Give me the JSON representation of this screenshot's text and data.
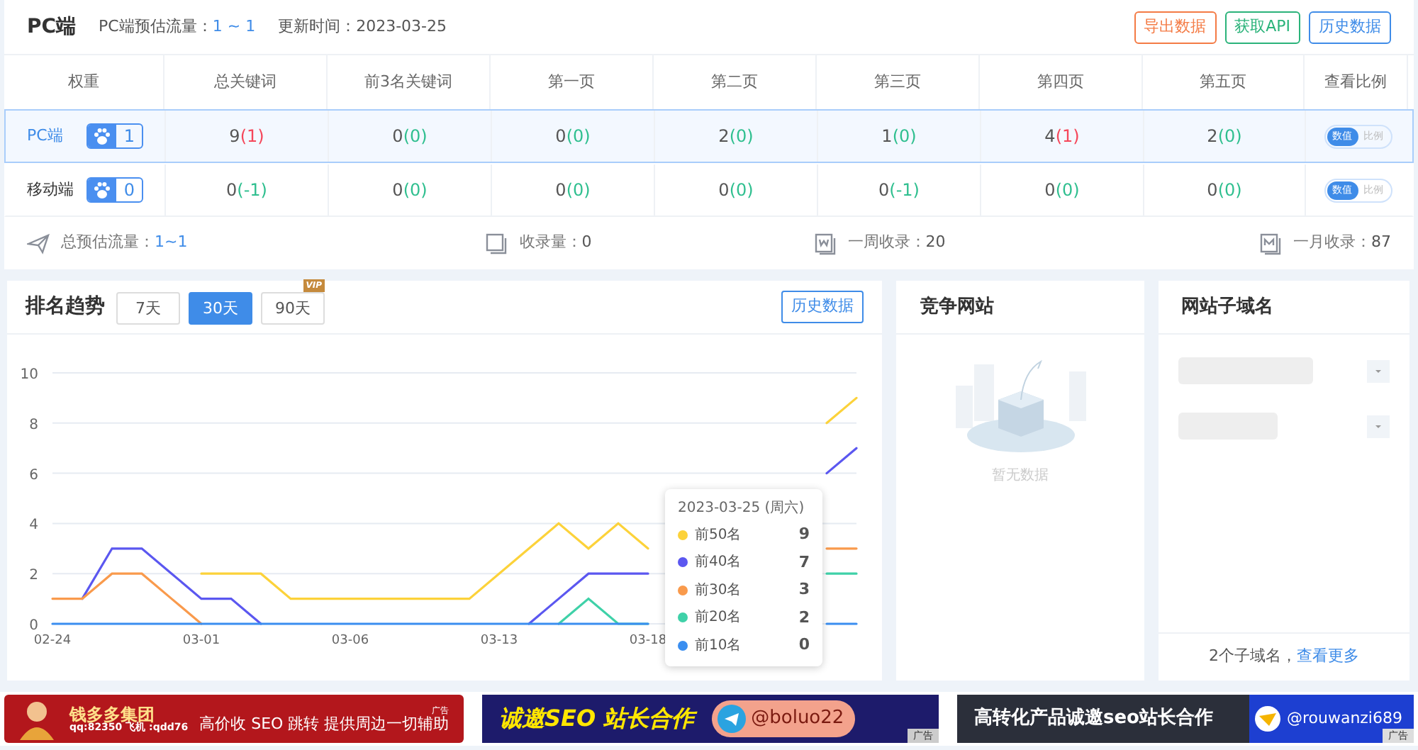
{
  "header": {
    "title": "PC端",
    "traffic_label": "PC端预估流量：",
    "traffic_value": "1 ~ 1",
    "update_label": "更新时间：2023-03-25",
    "buttons": [
      {
        "label": "导出数据",
        "color": "#f47b45"
      },
      {
        "label": "获取API",
        "color": "#2bb37a"
      },
      {
        "label": "历史数据",
        "color": "#3f8ce8"
      }
    ]
  },
  "table": {
    "weight_column": "权重",
    "columns": [
      "总关键词",
      "前3名关键词",
      "第一页",
      "第二页",
      "第三页",
      "第四页",
      "第五页"
    ],
    "ratio_column": "查看比例",
    "rows": [
      {
        "name": "PC端",
        "selected": true,
        "weight": "1",
        "cells": [
          {
            "value": "9",
            "change": "(1)",
            "color": "#f5475b"
          },
          {
            "value": "0",
            "change": "(0)",
            "color": "#2fbf8f"
          },
          {
            "value": "0",
            "change": "(0)",
            "color": "#2fbf8f"
          },
          {
            "value": "2",
            "change": "(0)",
            "color": "#2fbf8f"
          },
          {
            "value": "1",
            "change": "(0)",
            "color": "#2fbf8f"
          },
          {
            "value": "4",
            "change": "(1)",
            "color": "#f5475b"
          },
          {
            "value": "2",
            "change": "(0)",
            "color": "#2fbf8f"
          }
        ],
        "toggle": [
          {
            "label": "数值",
            "selected": true
          },
          {
            "label": "比例",
            "selected": false
          }
        ]
      },
      {
        "name": "移动端",
        "selected": false,
        "weight": "0",
        "cells": [
          {
            "value": "0",
            "change": "(-1)",
            "color": "#2fbf8f"
          },
          {
            "value": "0",
            "change": "(0)",
            "color": "#2fbf8f"
          },
          {
            "value": "0",
            "change": "(0)",
            "color": "#2fbf8f"
          },
          {
            "value": "0",
            "change": "(0)",
            "color": "#2fbf8f"
          },
          {
            "value": "0",
            "change": "(-1)",
            "color": "#2fbf8f"
          },
          {
            "value": "0",
            "change": "(0)",
            "color": "#2fbf8f"
          },
          {
            "value": "0",
            "change": "(0)",
            "color": "#2fbf8f"
          }
        ],
        "toggle": [
          {
            "label": "数值",
            "selected": true
          },
          {
            "label": "比例",
            "selected": false
          }
        ]
      }
    ]
  },
  "stats": [
    {
      "kind": "plane",
      "label": "总预估流量：",
      "value": "1~1"
    },
    {
      "kind": "page",
      "label": "收录量：",
      "value": "0"
    },
    {
      "kind": "week",
      "label": "一周收录：",
      "value": "20"
    },
    {
      "kind": "month",
      "label": "一月收录：",
      "value": "87"
    }
  ],
  "trend": {
    "title": "排名趋势",
    "ranges": [
      {
        "label": "7天",
        "selected": false
      },
      {
        "label": "30天",
        "selected": true
      },
      {
        "label": "90天",
        "selected": false,
        "badge": "VIP"
      }
    ],
    "history_button": "历史数据",
    "chart_data": {
      "type": "line",
      "categories": [
        "02-24",
        null,
        null,
        null,
        null,
        "03-01",
        null,
        null,
        null,
        null,
        "03-06",
        null,
        null,
        null,
        null,
        "03-13",
        null,
        null,
        null,
        null,
        "03-18",
        null,
        null,
        null,
        null,
        null,
        null,
        null
      ],
      "ylim": [
        0,
        10
      ],
      "yticks": [
        0,
        2,
        4,
        6,
        8,
        10
      ],
      "grid": true,
      "series": [
        {
          "name": "前50名",
          "color": "#fcd23a",
          "values": [
            null,
            null,
            null,
            null,
            null,
            2,
            2,
            2,
            1,
            1,
            1,
            1,
            1,
            1,
            1,
            2,
            3,
            4,
            3,
            4,
            3,
            null,
            null,
            null,
            null,
            null,
            8,
            9
          ]
        },
        {
          "name": "前40名",
          "color": "#5b57f0",
          "values": [
            null,
            1,
            3,
            3,
            2,
            1,
            1,
            0,
            null,
            null,
            null,
            null,
            null,
            null,
            null,
            null,
            0,
            1,
            2,
            2,
            2,
            null,
            null,
            null,
            null,
            null,
            6,
            7
          ]
        },
        {
          "name": "前30名",
          "color": "#f99a4c",
          "values": [
            1,
            1,
            2,
            2,
            1,
            0,
            null,
            null,
            null,
            null,
            null,
            null,
            null,
            null,
            null,
            null,
            null,
            null,
            null,
            null,
            null,
            null,
            null,
            null,
            null,
            null,
            3,
            3
          ]
        },
        {
          "name": "前20名",
          "color": "#3fd1a8",
          "values": [
            null,
            null,
            null,
            null,
            null,
            null,
            null,
            null,
            null,
            null,
            null,
            null,
            null,
            null,
            null,
            null,
            null,
            0,
            1,
            0,
            0,
            null,
            null,
            null,
            null,
            null,
            2,
            2
          ]
        },
        {
          "name": "前10名",
          "color": "#3a8ef0",
          "values": [
            0,
            0,
            0,
            0,
            0,
            0,
            0,
            0,
            0,
            0,
            0,
            0,
            0,
            0,
            0,
            0,
            0,
            0,
            0,
            0,
            0,
            null,
            null,
            null,
            null,
            null,
            0,
            0
          ]
        }
      ]
    },
    "tooltip": {
      "title": "2023-03-25 (周六)",
      "values": [
        "9",
        "7",
        "3",
        "2",
        "0"
      ]
    }
  },
  "competitors": {
    "title": "竞争网站",
    "empty_text": "暂无数据"
  },
  "subdomains": {
    "title": "网站子域名",
    "footer_text": "2个子域名，",
    "footer_link": "查看更多"
  },
  "ads": [
    {
      "kind": "red",
      "brand": "钱多多集团",
      "contact": "qq:82350 飞机 :qdd76",
      "text": "高价收 SEO 跳转  提供周边一切辅助",
      "tag": "广告"
    },
    {
      "kind": "navy",
      "text": "诚邀SEO 站长合作",
      "handle": "@boluo22",
      "tag": "广告"
    },
    {
      "kind": "dark",
      "text": "高转化产品诚邀seo站长合作",
      "handle": "@rouwanzi689",
      "tag": "广告"
    }
  ]
}
